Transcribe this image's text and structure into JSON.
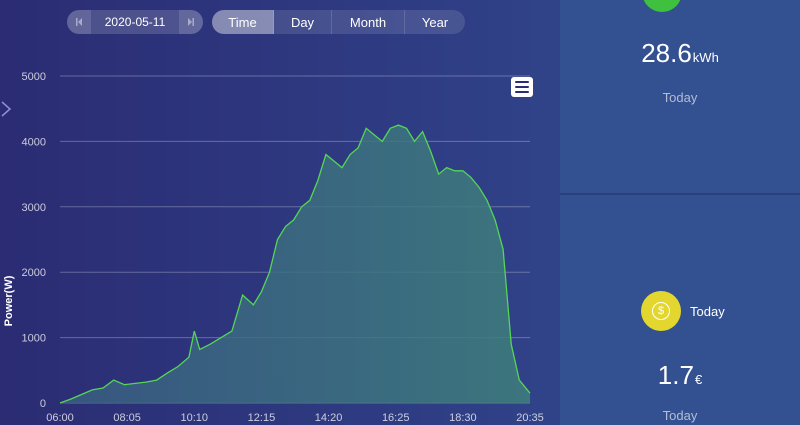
{
  "date_picker": {
    "date": "2020-05-11"
  },
  "range_tabs": [
    {
      "label": "Time",
      "active": true
    },
    {
      "label": "Day",
      "active": false
    },
    {
      "label": "Month",
      "active": false
    },
    {
      "label": "Year",
      "active": false
    }
  ],
  "chart_data": {
    "type": "area",
    "ylabel": "Power(W)",
    "ylim": [
      0,
      5000
    ],
    "yticks": [
      0,
      1000,
      2000,
      3000,
      4000,
      5000
    ],
    "xlim": [
      "06:00",
      "20:35"
    ],
    "xticks": [
      "06:00",
      "08:05",
      "10:10",
      "12:15",
      "14:20",
      "16:25",
      "18:30",
      "20:35"
    ],
    "grid": true,
    "line_color": "#55d655",
    "x": [
      "06:00",
      "06:20",
      "06:40",
      "07:00",
      "07:20",
      "07:40",
      "08:00",
      "08:20",
      "08:40",
      "09:00",
      "09:20",
      "09:40",
      "10:00",
      "10:10",
      "10:20",
      "10:40",
      "11:00",
      "11:20",
      "11:40",
      "12:00",
      "12:15",
      "12:30",
      "12:45",
      "13:00",
      "13:15",
      "13:30",
      "13:45",
      "14:00",
      "14:15",
      "14:30",
      "14:45",
      "15:00",
      "15:15",
      "15:30",
      "15:45",
      "16:00",
      "16:15",
      "16:30",
      "16:45",
      "17:00",
      "17:15",
      "17:30",
      "17:45",
      "18:00",
      "18:15",
      "18:30",
      "18:45",
      "19:00",
      "19:15",
      "19:30",
      "19:45",
      "20:00",
      "20:15",
      "20:35"
    ],
    "values": [
      0,
      60,
      130,
      200,
      230,
      350,
      280,
      300,
      320,
      350,
      460,
      560,
      700,
      1100,
      820,
      900,
      1000,
      1100,
      1650,
      1500,
      1700,
      2000,
      2500,
      2700,
      2800,
      3000,
      3100,
      3400,
      3800,
      3700,
      3600,
      3800,
      3900,
      4200,
      4100,
      4000,
      4200,
      4250,
      4200,
      4000,
      4150,
      3850,
      3500,
      3600,
      3550,
      3550,
      3450,
      3300,
      3100,
      2800,
      2350,
      900,
      350,
      150
    ]
  },
  "energy_card": {
    "value": "28.6",
    "unit": "kWh",
    "label": "Today"
  },
  "income_card": {
    "title": "Today",
    "value": "1.7",
    "unit": "€",
    "label": "Today"
  },
  "colors": {
    "accent_green": "#3fc03f",
    "coin_yellow": "#e3d72f",
    "panel_bg": "#335090"
  },
  "icons": {
    "prev": "skip-back-icon",
    "next": "skip-forward-icon",
    "menu": "hamburger-menu-icon",
    "coin": "dollar-coin-icon",
    "energy": "green-circle-icon",
    "side": "chevron-right-icon"
  }
}
